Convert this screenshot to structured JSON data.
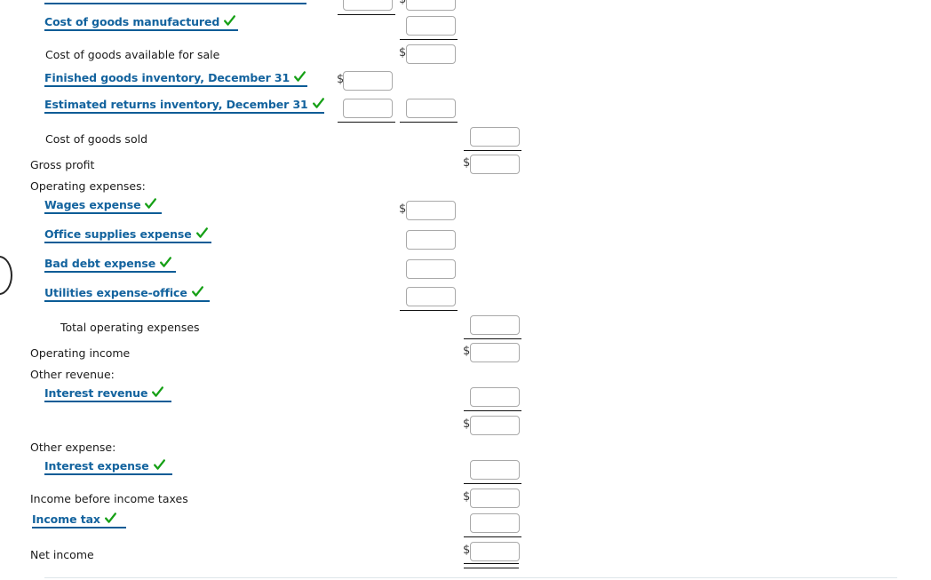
{
  "document": {
    "type": "income-statement-worksheet",
    "accent_blue": "#13639e",
    "rule_blue": "#0b5c96",
    "check_green": "#16a016",
    "currency_symbol": "$"
  },
  "rows": [
    {
      "id": "cost-of-goods-manufactured",
      "label": "Cost of goods manufactured",
      "kind": "answer",
      "indent": 2,
      "checked": true
    },
    {
      "id": "cost-of-goods-available-for-sale",
      "label": "Cost of goods available for sale",
      "kind": "static",
      "indent": 1
    },
    {
      "id": "finished-goods-inventory-december-31",
      "label": "Finished goods inventory, December 31",
      "kind": "answer",
      "indent": 2,
      "checked": true
    },
    {
      "id": "estimated-returns-inventory-december-31",
      "label": "Estimated returns inventory, December 31",
      "kind": "answer",
      "indent": 2,
      "checked": true
    },
    {
      "id": "cost-of-goods-sold",
      "label": "Cost of goods sold",
      "kind": "static",
      "indent": 2
    },
    {
      "id": "gross-profit",
      "label": "Gross profit",
      "kind": "static",
      "indent": 0
    },
    {
      "id": "operating-expenses-heading",
      "label": "Operating expenses:",
      "kind": "static",
      "indent": 0
    },
    {
      "id": "wages-expense",
      "label": "Wages expense",
      "kind": "answer",
      "indent": 2,
      "checked": true
    },
    {
      "id": "office-supplies-expense",
      "label": "Office supplies expense",
      "kind": "answer",
      "indent": 2,
      "checked": true
    },
    {
      "id": "bad-debt-expense",
      "label": "Bad debt expense",
      "kind": "answer",
      "indent": 2,
      "checked": true
    },
    {
      "id": "utilities-expense-office",
      "label": "Utilities expense-office",
      "kind": "answer",
      "indent": 2,
      "checked": true
    },
    {
      "id": "total-operating-expenses",
      "label": "Total operating expenses",
      "kind": "static",
      "indent": 3
    },
    {
      "id": "operating-income",
      "label": "Operating income",
      "kind": "static",
      "indent": 0
    },
    {
      "id": "other-revenue-heading",
      "label": "Other revenue:",
      "kind": "static",
      "indent": 0
    },
    {
      "id": "interest-revenue",
      "label": "Interest revenue",
      "kind": "answer",
      "indent": 2,
      "checked": true
    },
    {
      "id": "other-expense-heading",
      "label": "Other expense:",
      "kind": "static",
      "indent": 0
    },
    {
      "id": "interest-expense",
      "label": "Interest expense",
      "kind": "answer",
      "indent": 2,
      "checked": true
    },
    {
      "id": "income-before-income-taxes",
      "label": "Income before income taxes",
      "kind": "static",
      "indent": 0
    },
    {
      "id": "income-tax",
      "label": "Income tax",
      "kind": "answer",
      "indent": 1,
      "checked": true
    },
    {
      "id": "net-income",
      "label": "Net income",
      "kind": "static",
      "indent": 0
    }
  ],
  "amount_inputs": [
    {
      "id": "amount-col1-top-partial",
      "column": 1,
      "value": "",
      "dollar": false
    },
    {
      "id": "amount-col2-top-partial",
      "column": 2,
      "value": "",
      "dollar": true
    },
    {
      "id": "amount-cost-goods-manufactured",
      "column": 2,
      "value": "",
      "dollar": false
    },
    {
      "id": "amount-cost-goods-available",
      "column": 2,
      "value": "",
      "dollar": true
    },
    {
      "id": "amount-finished-goods-inventory",
      "column": 1,
      "value": "",
      "dollar": true
    },
    {
      "id": "amount-estimated-returns-col1",
      "column": 1,
      "value": "",
      "dollar": false
    },
    {
      "id": "amount-estimated-returns-col2",
      "column": 2,
      "value": "",
      "dollar": false
    },
    {
      "id": "amount-cost-of-goods-sold",
      "column": 3,
      "value": "",
      "dollar": false
    },
    {
      "id": "amount-gross-profit",
      "column": 3,
      "value": "",
      "dollar": true
    },
    {
      "id": "amount-wages-expense",
      "column": 2,
      "value": "",
      "dollar": true
    },
    {
      "id": "amount-office-supplies-expense",
      "column": 2,
      "value": "",
      "dollar": false
    },
    {
      "id": "amount-bad-debt-expense",
      "column": 2,
      "value": "",
      "dollar": false
    },
    {
      "id": "amount-utilities-expense-office",
      "column": 2,
      "value": "",
      "dollar": false
    },
    {
      "id": "amount-total-operating-expenses",
      "column": 3,
      "value": "",
      "dollar": false
    },
    {
      "id": "amount-operating-income",
      "column": 3,
      "value": "",
      "dollar": true
    },
    {
      "id": "amount-interest-revenue",
      "column": 3,
      "value": "",
      "dollar": false
    },
    {
      "id": "amount-other-revenue-total",
      "column": 3,
      "value": "",
      "dollar": true
    },
    {
      "id": "amount-interest-expense",
      "column": 3,
      "value": "",
      "dollar": false
    },
    {
      "id": "amount-income-before-taxes",
      "column": 3,
      "value": "",
      "dollar": true
    },
    {
      "id": "amount-income-tax",
      "column": 3,
      "value": "",
      "dollar": false
    },
    {
      "id": "amount-net-income",
      "column": 3,
      "value": "",
      "dollar": true
    }
  ]
}
